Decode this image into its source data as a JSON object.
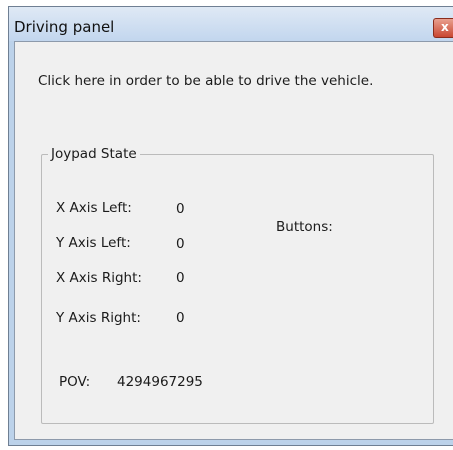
{
  "window": {
    "title": "Driving panel",
    "close_glyph": "x"
  },
  "panel": {
    "drive_link": "Click here in order to be able to drive the vehicle."
  },
  "joypad": {
    "group_label": "Joypad State",
    "x_axis_left_label": "X Axis Left:",
    "x_axis_left_value": "0",
    "y_axis_left_label": "Y Axis Left:",
    "y_axis_left_value": "0",
    "x_axis_right_label": "X Axis Right:",
    "x_axis_right_value": "0",
    "y_axis_right_label": "Y Axis Right:",
    "y_axis_right_value": "0",
    "buttons_label": "Buttons:",
    "pov_label": "POV:",
    "pov_value": "4294967295"
  }
}
